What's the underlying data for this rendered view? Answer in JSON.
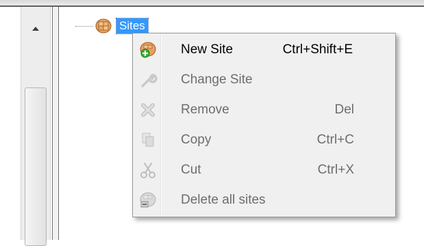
{
  "tree": {
    "node_label": "Sites",
    "node_icon": "sites-icon"
  },
  "context_menu": {
    "items": [
      {
        "label": "New Site",
        "shortcut": "Ctrl+Shift+E",
        "icon": "new-site-icon",
        "enabled": true
      },
      {
        "label": "Change Site",
        "shortcut": "",
        "icon": "wrench-icon",
        "enabled": false
      },
      {
        "label": "Remove",
        "shortcut": "Del",
        "icon": "remove-x-icon",
        "enabled": false
      },
      {
        "label": "Copy",
        "shortcut": "Ctrl+C",
        "icon": "copy-icon",
        "enabled": false
      },
      {
        "label": "Cut",
        "shortcut": "Ctrl+X",
        "icon": "scissors-icon",
        "enabled": false
      },
      {
        "label": "Delete all sites",
        "shortcut": "",
        "icon": "delete-all-sites-icon",
        "enabled": false
      }
    ]
  },
  "colors": {
    "selection": "#3399ff",
    "menu_background": "#f0f0f0",
    "disabled_text": "#6d6d6d"
  }
}
